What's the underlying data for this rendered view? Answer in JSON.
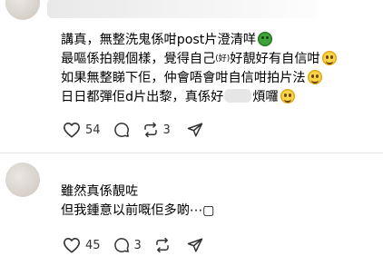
{
  "comments": [
    {
      "lines": [
        "講真，無整洗鬼係咁post片澄清咩",
        "最嘔係拍親個樣，覺得自己",
        "如果無整睇下佢，仲會唔會咁自信咁拍片法",
        "日日都彈佢d片出黎，真係好",
        "煩囉"
      ],
      "inline_censor": "(好)",
      "line2_tail": "好靚好有自信咁",
      "likes": "54",
      "replies": "",
      "reposts": "3"
    },
    {
      "lines": [
        "雖然真係靚咗",
        "但我鍾意以前嘅佢多啲⋯▢"
      ],
      "likes": "45",
      "replies": "3",
      "reposts": ""
    }
  ],
  "icons": {
    "like": "heart-icon",
    "reply": "comment-bubble-icon",
    "repost": "repost-arrows-icon",
    "share": "send-icon"
  },
  "colors": {
    "text": "#000000",
    "icon": "#333333",
    "divider": "#e5e5e5",
    "avatar": "#d9d3cd"
  }
}
